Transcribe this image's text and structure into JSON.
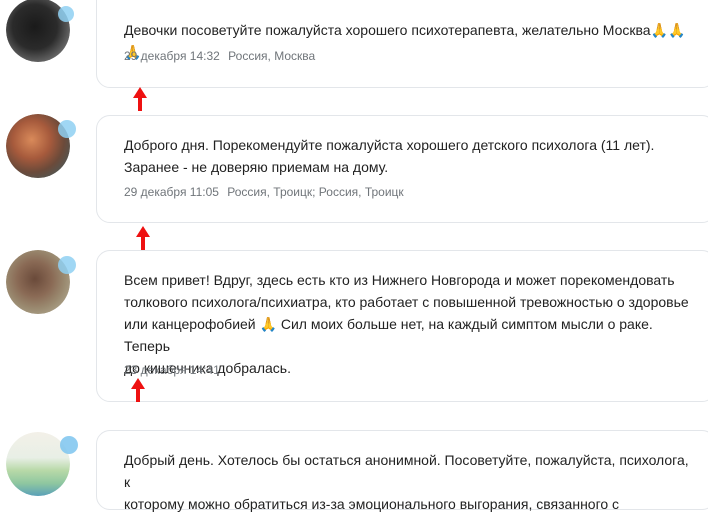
{
  "posts": [
    {
      "text": "Девочки посоветуйте пожалуйста хорошего психотерапевта, желательно Москва🙏🙏🙏",
      "date": "29 декабря 14:32",
      "location": "Россия, Москва"
    },
    {
      "text_line1": "Доброго дня. Порекомендуйте пожалуйста хорошего детского психолога (11 лет).",
      "text_line2": "Заранее - не доверяю приемам на дому.",
      "date": "29 декабря 11:05",
      "location": "Россия, Троицк; Россия, Троицк"
    },
    {
      "text_line1": "Всем привет! Вдруг, здесь есть кто из Нижнего Новгорода и может порекомендовать",
      "text_line2": "толкового психолога/психиатра, кто работает с повышенной тревожностью о здоровье",
      "text_line3": "или канцерофобией 🙏 Сил моих больше нет, на каждый симптом мысли о раке. Теперь",
      "text_line4": "до кишечника добралась.",
      "date": "23 декабря 14:41"
    },
    {
      "text_line1": "Добрый день. Хотелось бы остаться анонимной. Посоветуйте, пожалуйста, психолога, к",
      "text_line2": "которому можно обратиться из-за эмоционального выгорания, связанного с"
    }
  ],
  "colors": {
    "arrow": "#ee1111",
    "card_border": "#e3e6ea",
    "meta_text": "#70757a",
    "badge": "#8fd0f2"
  },
  "icons": [
    "up-arrow-icon",
    "verified-badge-icon",
    "avatar"
  ]
}
